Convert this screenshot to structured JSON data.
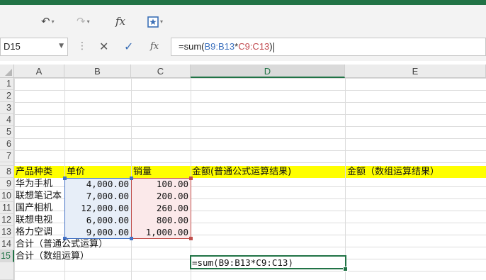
{
  "colors": {
    "accent": "#217346",
    "header_row_fill": "#ffff00",
    "ref_b": "#4472c4",
    "ref_c": "#c0504d"
  },
  "qat": {
    "undo_icon": "undo-icon",
    "redo_icon": "redo-icon",
    "fx_label": "fx",
    "form_icon": "form-icon"
  },
  "name_box": "D15",
  "formula_bar": {
    "fx_label": "fx",
    "prefix": "=sum(",
    "ref1": "B9:B13",
    "op": "*",
    "ref2": "C9:C13",
    "suffix": ")"
  },
  "columns": [
    "A",
    "B",
    "C",
    "D",
    "E"
  ],
  "rows": [
    "1",
    "2",
    "3",
    "4",
    "5",
    "6",
    "7",
    "8",
    "9",
    "10",
    "11",
    "12",
    "13",
    "14",
    "15"
  ],
  "header_row": {
    "a": "产品种类",
    "b": "单价",
    "c": "销量",
    "d": "金额(普通公式运算结果)",
    "e": "金额（数组运算结果）"
  },
  "data_rows": [
    {
      "product": "华为手机",
      "price": "4,000.00",
      "qty": "100.00"
    },
    {
      "product": "联想笔记本",
      "price": "7,000.00",
      "qty": "200.00"
    },
    {
      "product": "国产相机",
      "price": "12,000.00",
      "qty": "260.00"
    },
    {
      "product": "联想电视",
      "price": "6,000.00",
      "qty": "800.00"
    },
    {
      "product": "格力空调",
      "price": "9,000.00",
      "qty": "1,000.00"
    }
  ],
  "row14_label": "合计（普通公式运算）",
  "row15_label": "合计（数组运算）",
  "active_cell_text": "=sum(B9:B13*C9:C13)"
}
